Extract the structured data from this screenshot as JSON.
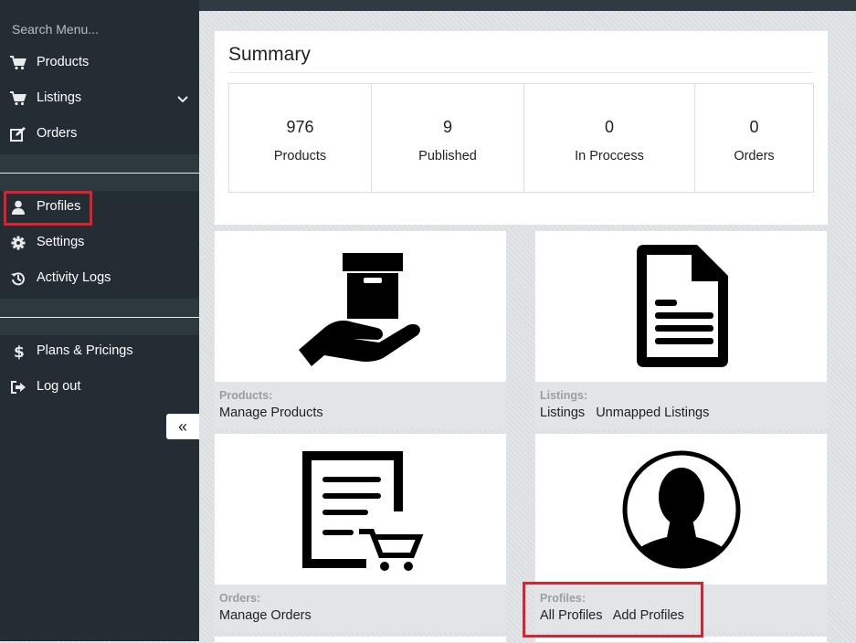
{
  "sidebar": {
    "search_placeholder": "Search Menu...",
    "items": [
      {
        "label": "Products",
        "icon": "cart-icon"
      },
      {
        "label": "Listings",
        "icon": "cart-icon"
      },
      {
        "label": "Orders",
        "icon": "edit-icon"
      },
      {
        "label": "Profiles",
        "icon": "user-icon"
      },
      {
        "label": "Settings",
        "icon": "gear-icon"
      },
      {
        "label": "Activity Logs",
        "icon": "history-icon"
      },
      {
        "label": "Plans & Pricings",
        "icon": "dollar-icon"
      },
      {
        "label": "Log out",
        "icon": "logout-icon"
      }
    ],
    "collapse_glyph": "«"
  },
  "summary": {
    "title": "Summary",
    "stats": [
      {
        "value": "976",
        "label": "Products"
      },
      {
        "value": "9",
        "label": "Published"
      },
      {
        "value": "0",
        "label": "In Proccess"
      },
      {
        "value": "0",
        "label": "Orders"
      }
    ]
  },
  "cards": [
    {
      "title": "Products:",
      "links": [
        "Manage Products"
      ],
      "icon": "box-in-hand-icon"
    },
    {
      "title": "Listings:",
      "links": [
        "Listings",
        "Unmapped Listings"
      ],
      "icon": "document-icon"
    },
    {
      "title": "Orders:",
      "links": [
        "Manage Orders"
      ],
      "icon": "order-list-cart-icon"
    },
    {
      "title": "Profiles:",
      "links": [
        "All Profiles",
        "Add Profiles"
      ],
      "icon": "profile-avatar-icon"
    }
  ],
  "colors": {
    "sidebar_bg": "#232d33",
    "highlight": "#e0202e"
  }
}
